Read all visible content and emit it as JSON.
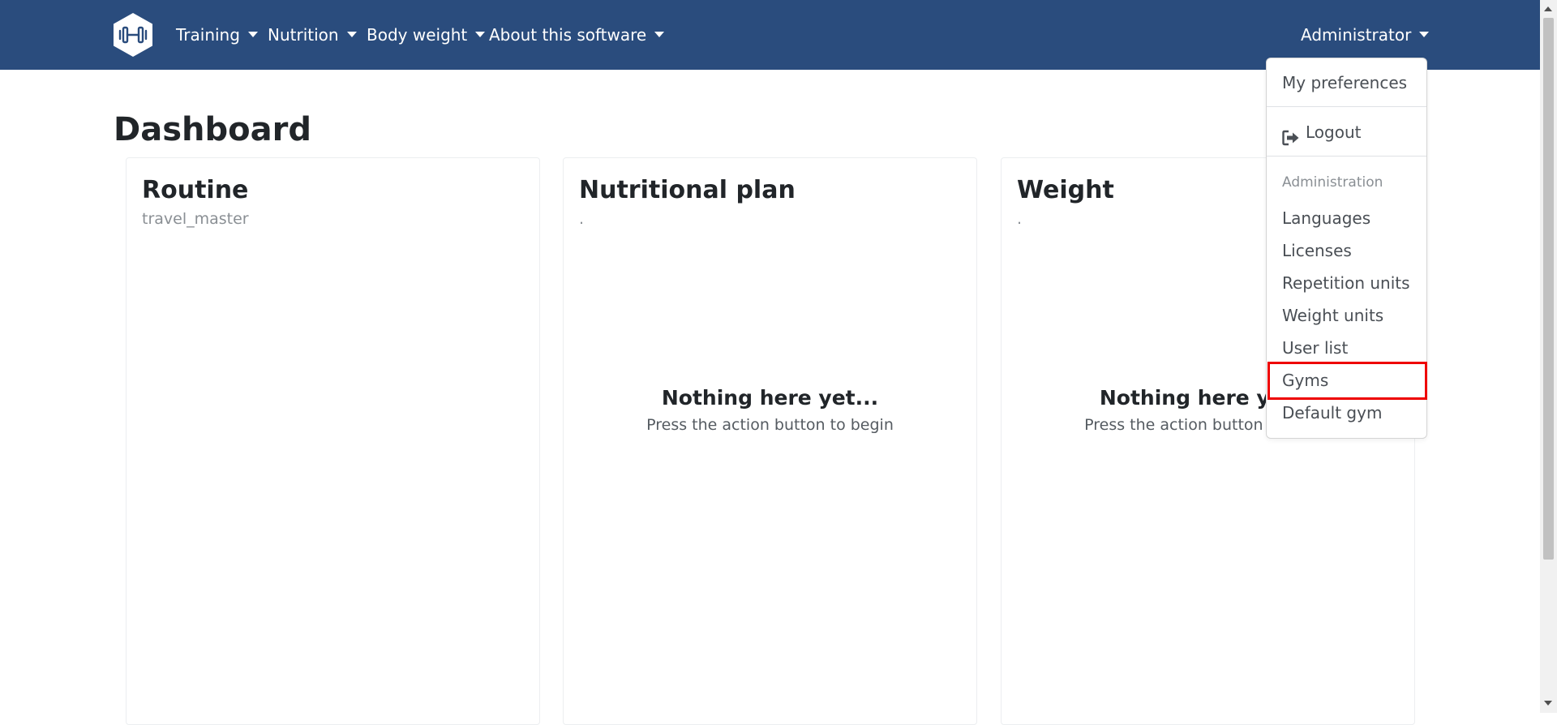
{
  "navbar": {
    "brand_icon": "dumbbell-hexagon-logo",
    "menus": [
      {
        "label": "Training"
      },
      {
        "label": "Nutrition"
      },
      {
        "label": "Body weight"
      },
      {
        "label": "About this software"
      }
    ],
    "user_menu": {
      "label": "Administrator"
    }
  },
  "page": {
    "title": "Dashboard"
  },
  "cards": [
    {
      "title": "Routine",
      "subtitle": "travel_master",
      "empty_title": "",
      "empty_text": ""
    },
    {
      "title": "Nutritional plan",
      "subtitle": ".",
      "empty_title": "Nothing here yet...",
      "empty_text": "Press the action button to begin"
    },
    {
      "title": "Weight",
      "subtitle": ".",
      "empty_title": "Nothing here yet...",
      "empty_text": "Press the action button to begin"
    }
  ],
  "user_dropdown": {
    "preferences": "My preferences",
    "logout": "Logout",
    "logout_icon": "sign-out-icon",
    "section_header": "Administration",
    "admin_items": [
      {
        "label": "Languages"
      },
      {
        "label": "Licenses"
      },
      {
        "label": "Repetition units"
      },
      {
        "label": "Weight units"
      },
      {
        "label": "User list"
      },
      {
        "label": "Gyms",
        "highlighted": true
      },
      {
        "label": "Default gym"
      }
    ]
  },
  "colors": {
    "navbar_bg": "#2a4c7d",
    "highlight_border": "#ee0000",
    "text_muted": "#8a8f94"
  }
}
